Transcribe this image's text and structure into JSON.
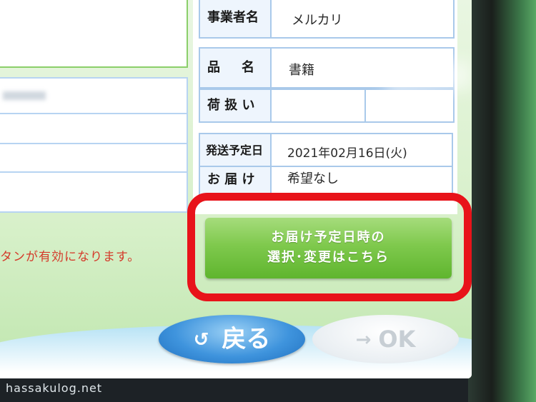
{
  "info": {
    "business_label": "事業者名",
    "business_value": "メルカリ",
    "item_label": "品　名",
    "item_value": "書籍",
    "handling_label": "荷 扱 い",
    "ship_date_label": "発送予定日",
    "ship_date_value": "2021年02月16日(火)",
    "delivery_label": "お 届 け",
    "delivery_value": "希望なし"
  },
  "notice_text": "タンが有効になります。",
  "delivery_button": {
    "line1": "お届け予定日時の",
    "line2": "選択･変更はこちら"
  },
  "back_button": {
    "label": "戻る",
    "icon": "return-arrow-icon"
  },
  "ok_button": {
    "label": "OK",
    "icon": "right-arrow-icon"
  },
  "watermark": "hassakulog.net",
  "colors": {
    "highlight": "#e8131a",
    "notice": "#d43a2a",
    "primary_button": "#7fc94d",
    "back_button": "#3f94dd"
  }
}
